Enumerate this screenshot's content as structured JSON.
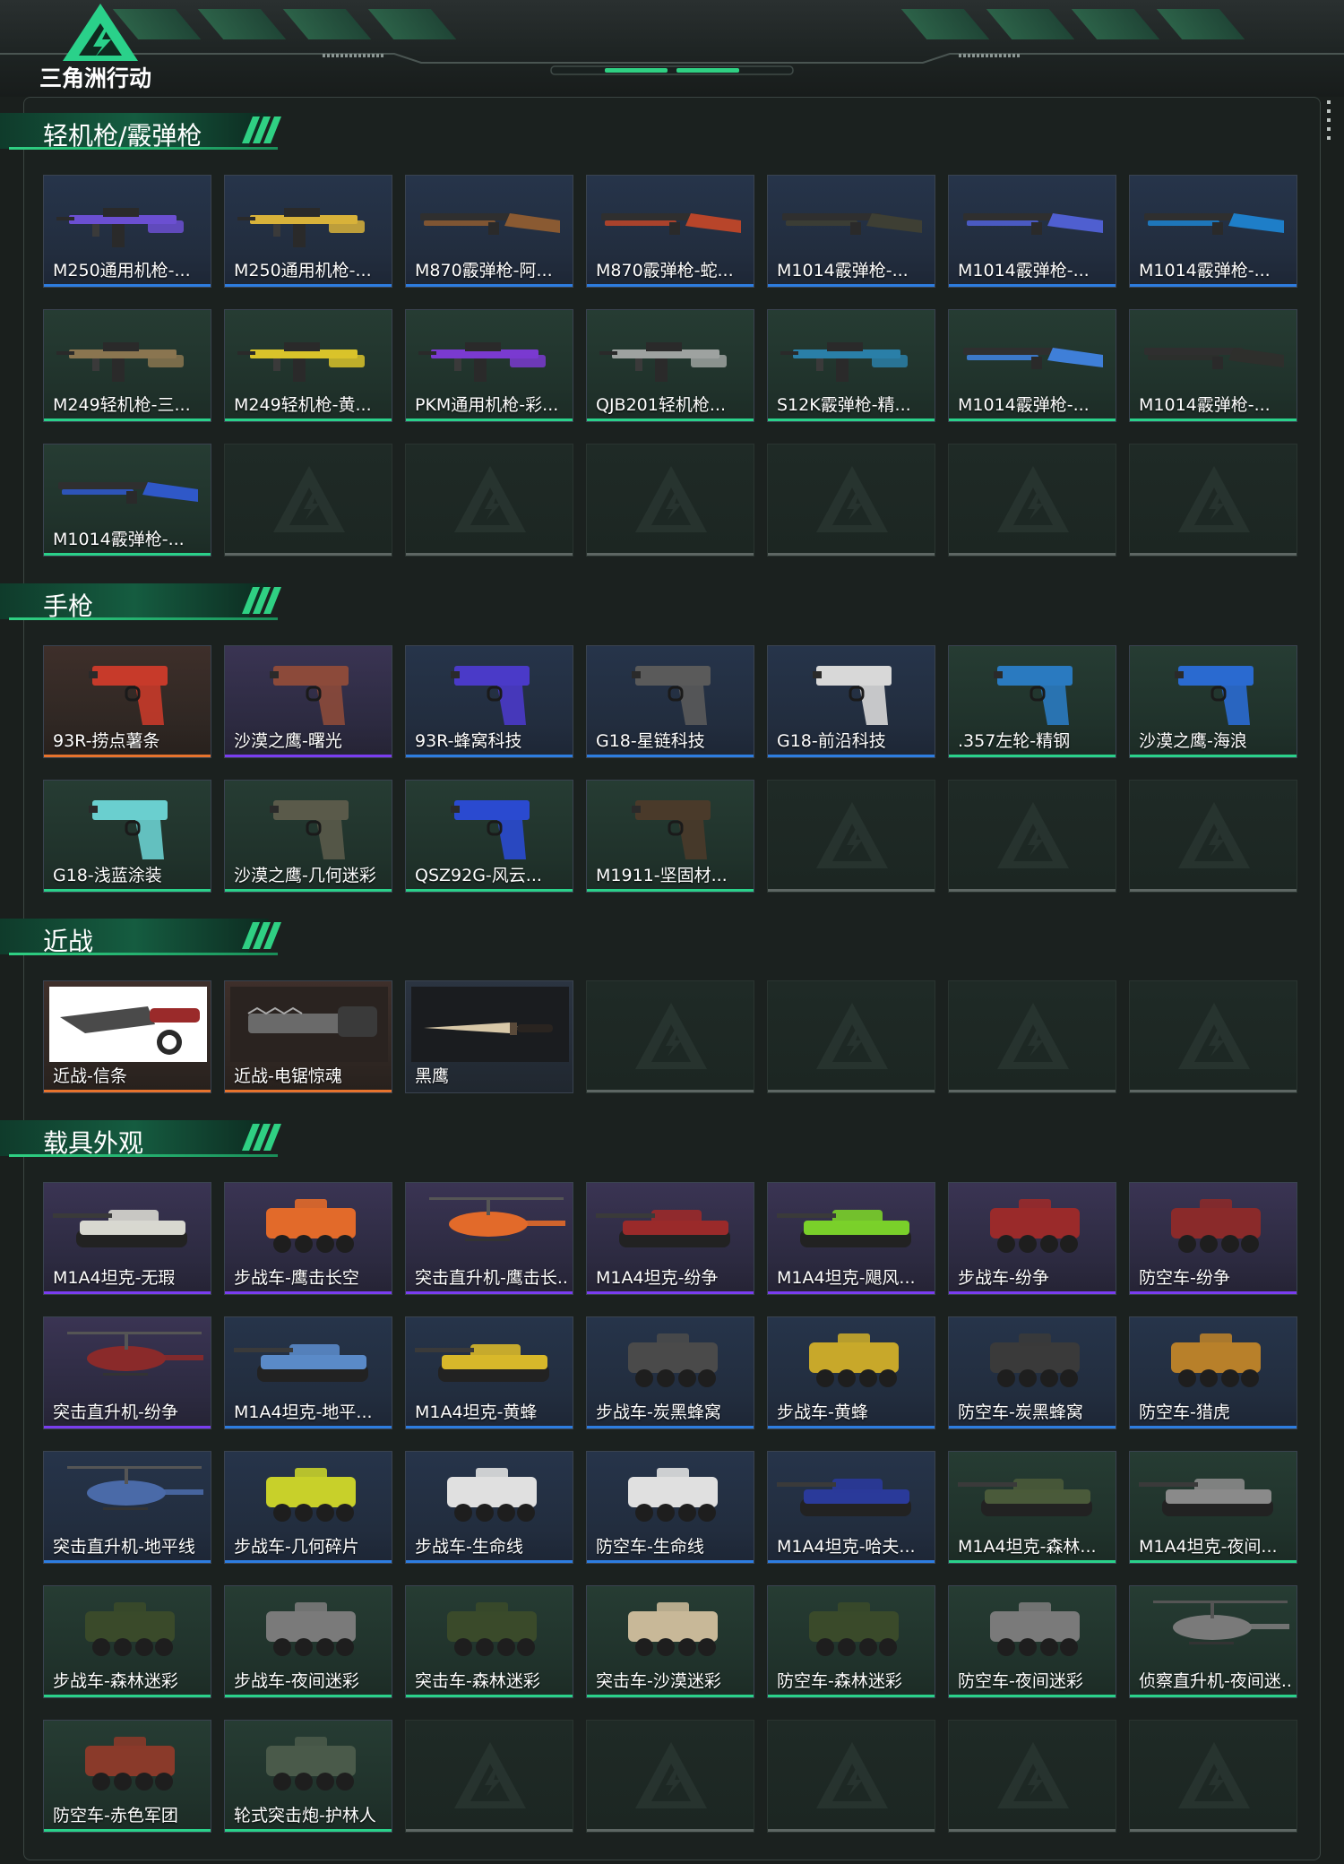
{
  "header": {
    "logo_text": "三角洲行动"
  },
  "sections": [
    {
      "title": "轻机枪/霰弹枪",
      "cards": [
        {
          "name": "M250通用机枪-...",
          "rarity": "blue",
          "art": "gun",
          "color": "#6b4fd1"
        },
        {
          "name": "M250通用机枪-...",
          "rarity": "blue",
          "art": "gun",
          "color": "#d8b23a"
        },
        {
          "name": "M870霰弹枪-阿...",
          "rarity": "blue",
          "art": "shotgun",
          "color": "#8a5a32"
        },
        {
          "name": "M870霰弹枪-蛇...",
          "rarity": "blue",
          "art": "shotgun",
          "color": "#b8452a"
        },
        {
          "name": "M1014霰弹枪-...",
          "rarity": "blue",
          "art": "shotgun",
          "color": "#3e3f34"
        },
        {
          "name": "M1014霰弹枪-...",
          "rarity": "blue",
          "art": "shotgun",
          "color": "#4f5fd0"
        },
        {
          "name": "M1014霰弹枪-...",
          "rarity": "blue",
          "art": "shotgun",
          "color": "#1e7ec8"
        },
        {
          "name": "M249轻机枪-三...",
          "rarity": "green",
          "art": "gun",
          "color": "#8a7550"
        },
        {
          "name": "M249轻机枪-黄...",
          "rarity": "green",
          "art": "gun",
          "color": "#d9c32a"
        },
        {
          "name": "PKM通用机枪-彩...",
          "rarity": "green",
          "art": "gun",
          "color": "#7a3ad0"
        },
        {
          "name": "QJB201轻机枪...",
          "rarity": "green",
          "art": "gun",
          "color": "#9ea2a0"
        },
        {
          "name": "S12K霰弹枪-精...",
          "rarity": "green",
          "art": "gun",
          "color": "#2a7fa8"
        },
        {
          "name": "M1014霰弹枪-...",
          "rarity": "green",
          "art": "shotgun",
          "color": "#3f7fd8"
        },
        {
          "name": "M1014霰弹枪-...",
          "rarity": "green",
          "art": "shotgun",
          "color": "#2e2f2c"
        },
        {
          "name": "M1014霰弹枪-...",
          "rarity": "green",
          "art": "shotgun",
          "color": "#2f58c8"
        },
        {
          "empty": true
        },
        {
          "empty": true
        },
        {
          "empty": true
        },
        {
          "empty": true
        },
        {
          "empty": true
        },
        {
          "empty": true
        }
      ]
    },
    {
      "title": "手枪",
      "cards": [
        {
          "name": "93R-捞点薯条",
          "rarity": "orange",
          "art": "pistol",
          "color": "#c73a2a"
        },
        {
          "name": "沙漠之鹰-曙光",
          "rarity": "purple",
          "art": "pistol",
          "color": "#8c4a3a"
        },
        {
          "name": "93R-蜂窝科技",
          "rarity": "blue",
          "art": "pistol",
          "color": "#4a3ac8"
        },
        {
          "name": "G18-星链科技",
          "rarity": "blue",
          "art": "pistol",
          "color": "#5a5a5a"
        },
        {
          "name": "G18-前沿科技",
          "rarity": "blue",
          "art": "pistol",
          "color": "#d8d8d8"
        },
        {
          "name": ".357左轮-精钢",
          "rarity": "green",
          "art": "pistol",
          "color": "#2a7ac0"
        },
        {
          "name": "沙漠之鹰-海浪",
          "rarity": "green",
          "art": "pistol",
          "color": "#2a6ad0"
        },
        {
          "name": "G18-浅蓝涂装",
          "rarity": "green",
          "art": "pistol",
          "color": "#6acfcf"
        },
        {
          "name": "沙漠之鹰-几何迷彩",
          "rarity": "green",
          "art": "pistol",
          "color": "#5a5a4a"
        },
        {
          "name": "QSZ92G-风云...",
          "rarity": "green",
          "art": "pistol",
          "color": "#2a4ad0"
        },
        {
          "name": "M1911-坚固材...",
          "rarity": "green",
          "art": "pistol",
          "color": "#4a3a2a"
        },
        {
          "empty": true
        },
        {
          "empty": true
        },
        {
          "empty": true
        }
      ]
    },
    {
      "title": "近战",
      "cards": [
        {
          "name": "近战-信条",
          "rarity": "orange",
          "art": "knife-white",
          "color": "#d8d8d8"
        },
        {
          "name": "近战-电锯惊魂",
          "rarity": "orange",
          "art": "saw",
          "color": "#6a6a6a"
        },
        {
          "name": "黑鹰",
          "rarity": "none",
          "art": "knife",
          "color": "#d8c8a8"
        },
        {
          "empty": true
        },
        {
          "empty": true
        },
        {
          "empty": true
        },
        {
          "empty": true
        }
      ]
    },
    {
      "title": "载具外观",
      "cards": [
        {
          "name": "M1A4坦克-无瑕",
          "rarity": "purple",
          "art": "tank",
          "color": "#d8d8d0"
        },
        {
          "name": "步战车-鹰击长空",
          "rarity": "purple",
          "art": "ifv",
          "color": "#e26a2a"
        },
        {
          "name": "突击直升机-鹰击长...",
          "rarity": "purple",
          "art": "heli",
          "color": "#e26a2a"
        },
        {
          "name": "M1A4坦克-纷争",
          "rarity": "purple",
          "art": "tank",
          "color": "#9a2a2a"
        },
        {
          "name": "M1A4坦克-飓风...",
          "rarity": "purple",
          "art": "tank",
          "color": "#7ad02a"
        },
        {
          "name": "步战车-纷争",
          "rarity": "purple",
          "art": "ifv",
          "color": "#9a2a2a"
        },
        {
          "name": "防空车-纷争",
          "rarity": "purple",
          "art": "ifv",
          "color": "#8a2a2a"
        },
        {
          "name": "突击直升机-纷争",
          "rarity": "purple",
          "art": "heli",
          "color": "#8a2a2a"
        },
        {
          "name": "M1A4坦克-地平...",
          "rarity": "blue",
          "art": "tank",
          "color": "#5a8ac8"
        },
        {
          "name": "M1A4坦克-黄蜂",
          "rarity": "blue",
          "art": "tank",
          "color": "#d8b82a"
        },
        {
          "name": "步战车-炭黑蜂窝",
          "rarity": "blue",
          "art": "ifv",
          "color": "#4a4a4a"
        },
        {
          "name": "步战车-黄蜂",
          "rarity": "blue",
          "art": "ifv",
          "color": "#c8a82a"
        },
        {
          "name": "防空车-炭黑蜂窝",
          "rarity": "blue",
          "art": "ifv",
          "color": "#3a3a3a"
        },
        {
          "name": "防空车-猎虎",
          "rarity": "blue",
          "art": "ifv",
          "color": "#b8802a"
        },
        {
          "name": "突击直升机-地平线",
          "rarity": "blue",
          "art": "heli",
          "color": "#4a6aa8"
        },
        {
          "name": "步战车-几何碎片",
          "rarity": "blue",
          "art": "ifv",
          "color": "#c8d02a"
        },
        {
          "name": "步战车-生命线",
          "rarity": "blue",
          "art": "ifv",
          "color": "#e0e0e0"
        },
        {
          "name": "防空车-生命线",
          "rarity": "blue",
          "art": "ifv",
          "color": "#e0e0e0"
        },
        {
          "name": "M1A4坦克-哈夫...",
          "rarity": "blue",
          "art": "tank",
          "color": "#2a3a9a"
        },
        {
          "name": "M1A4坦克-森林...",
          "rarity": "green",
          "art": "tank",
          "color": "#4a5a3a"
        },
        {
          "name": "M1A4坦克-夜间...",
          "rarity": "green",
          "art": "tank",
          "color": "#8a8a8a"
        },
        {
          "name": "步战车-森林迷彩",
          "rarity": "green",
          "art": "ifv",
          "color": "#3a4a2a"
        },
        {
          "name": "步战车-夜间迷彩",
          "rarity": "green",
          "art": "ifv",
          "color": "#7a7a7a"
        },
        {
          "name": "突击车-森林迷彩",
          "rarity": "green",
          "art": "ifv",
          "color": "#3a4a2a"
        },
        {
          "name": "突击车-沙漠迷彩",
          "rarity": "green",
          "art": "ifv",
          "color": "#c8b898"
        },
        {
          "name": "防空车-森林迷彩",
          "rarity": "green",
          "art": "ifv",
          "color": "#3a4a2a"
        },
        {
          "name": "防空车-夜间迷彩",
          "rarity": "green",
          "art": "ifv",
          "color": "#7a7a7a"
        },
        {
          "name": "侦察直升机-夜间迷...",
          "rarity": "green",
          "art": "heli",
          "color": "#7a7a7a"
        },
        {
          "name": "防空车-赤色军团",
          "rarity": "green",
          "art": "ifv",
          "color": "#8a3a2a"
        },
        {
          "name": "轮式突击炮-护林人",
          "rarity": "green",
          "art": "ifv",
          "color": "#4a5a4a"
        },
        {
          "empty": true
        },
        {
          "empty": true
        },
        {
          "empty": true
        },
        {
          "empty": true
        },
        {
          "empty": true
        }
      ]
    }
  ]
}
